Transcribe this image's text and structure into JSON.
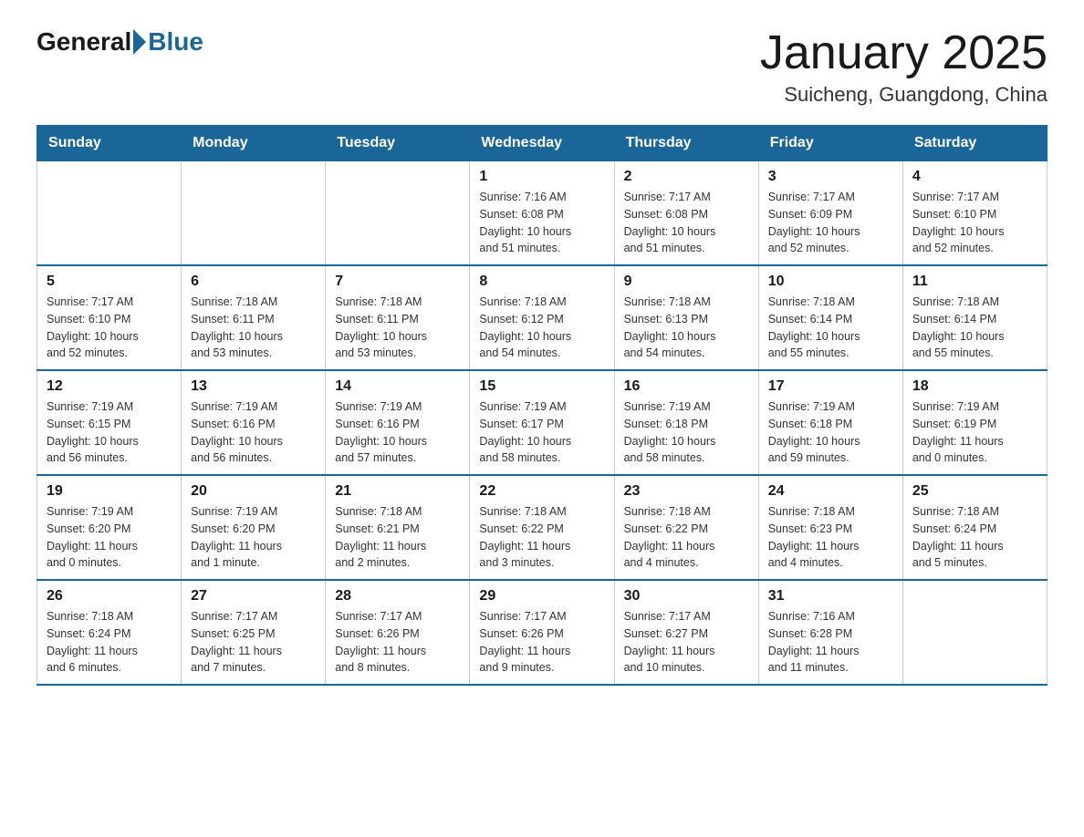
{
  "header": {
    "logo_general": "General",
    "logo_blue": "Blue",
    "month_title": "January 2025",
    "location": "Suicheng, Guangdong, China"
  },
  "days_of_week": [
    "Sunday",
    "Monday",
    "Tuesday",
    "Wednesday",
    "Thursday",
    "Friday",
    "Saturday"
  ],
  "weeks": [
    [
      {
        "day": "",
        "info": ""
      },
      {
        "day": "",
        "info": ""
      },
      {
        "day": "",
        "info": ""
      },
      {
        "day": "1",
        "info": "Sunrise: 7:16 AM\nSunset: 6:08 PM\nDaylight: 10 hours\nand 51 minutes."
      },
      {
        "day": "2",
        "info": "Sunrise: 7:17 AM\nSunset: 6:08 PM\nDaylight: 10 hours\nand 51 minutes."
      },
      {
        "day": "3",
        "info": "Sunrise: 7:17 AM\nSunset: 6:09 PM\nDaylight: 10 hours\nand 52 minutes."
      },
      {
        "day": "4",
        "info": "Sunrise: 7:17 AM\nSunset: 6:10 PM\nDaylight: 10 hours\nand 52 minutes."
      }
    ],
    [
      {
        "day": "5",
        "info": "Sunrise: 7:17 AM\nSunset: 6:10 PM\nDaylight: 10 hours\nand 52 minutes."
      },
      {
        "day": "6",
        "info": "Sunrise: 7:18 AM\nSunset: 6:11 PM\nDaylight: 10 hours\nand 53 minutes."
      },
      {
        "day": "7",
        "info": "Sunrise: 7:18 AM\nSunset: 6:11 PM\nDaylight: 10 hours\nand 53 minutes."
      },
      {
        "day": "8",
        "info": "Sunrise: 7:18 AM\nSunset: 6:12 PM\nDaylight: 10 hours\nand 54 minutes."
      },
      {
        "day": "9",
        "info": "Sunrise: 7:18 AM\nSunset: 6:13 PM\nDaylight: 10 hours\nand 54 minutes."
      },
      {
        "day": "10",
        "info": "Sunrise: 7:18 AM\nSunset: 6:14 PM\nDaylight: 10 hours\nand 55 minutes."
      },
      {
        "day": "11",
        "info": "Sunrise: 7:18 AM\nSunset: 6:14 PM\nDaylight: 10 hours\nand 55 minutes."
      }
    ],
    [
      {
        "day": "12",
        "info": "Sunrise: 7:19 AM\nSunset: 6:15 PM\nDaylight: 10 hours\nand 56 minutes."
      },
      {
        "day": "13",
        "info": "Sunrise: 7:19 AM\nSunset: 6:16 PM\nDaylight: 10 hours\nand 56 minutes."
      },
      {
        "day": "14",
        "info": "Sunrise: 7:19 AM\nSunset: 6:16 PM\nDaylight: 10 hours\nand 57 minutes."
      },
      {
        "day": "15",
        "info": "Sunrise: 7:19 AM\nSunset: 6:17 PM\nDaylight: 10 hours\nand 58 minutes."
      },
      {
        "day": "16",
        "info": "Sunrise: 7:19 AM\nSunset: 6:18 PM\nDaylight: 10 hours\nand 58 minutes."
      },
      {
        "day": "17",
        "info": "Sunrise: 7:19 AM\nSunset: 6:18 PM\nDaylight: 10 hours\nand 59 minutes."
      },
      {
        "day": "18",
        "info": "Sunrise: 7:19 AM\nSunset: 6:19 PM\nDaylight: 11 hours\nand 0 minutes."
      }
    ],
    [
      {
        "day": "19",
        "info": "Sunrise: 7:19 AM\nSunset: 6:20 PM\nDaylight: 11 hours\nand 0 minutes."
      },
      {
        "day": "20",
        "info": "Sunrise: 7:19 AM\nSunset: 6:20 PM\nDaylight: 11 hours\nand 1 minute."
      },
      {
        "day": "21",
        "info": "Sunrise: 7:18 AM\nSunset: 6:21 PM\nDaylight: 11 hours\nand 2 minutes."
      },
      {
        "day": "22",
        "info": "Sunrise: 7:18 AM\nSunset: 6:22 PM\nDaylight: 11 hours\nand 3 minutes."
      },
      {
        "day": "23",
        "info": "Sunrise: 7:18 AM\nSunset: 6:22 PM\nDaylight: 11 hours\nand 4 minutes."
      },
      {
        "day": "24",
        "info": "Sunrise: 7:18 AM\nSunset: 6:23 PM\nDaylight: 11 hours\nand 4 minutes."
      },
      {
        "day": "25",
        "info": "Sunrise: 7:18 AM\nSunset: 6:24 PM\nDaylight: 11 hours\nand 5 minutes."
      }
    ],
    [
      {
        "day": "26",
        "info": "Sunrise: 7:18 AM\nSunset: 6:24 PM\nDaylight: 11 hours\nand 6 minutes."
      },
      {
        "day": "27",
        "info": "Sunrise: 7:17 AM\nSunset: 6:25 PM\nDaylight: 11 hours\nand 7 minutes."
      },
      {
        "day": "28",
        "info": "Sunrise: 7:17 AM\nSunset: 6:26 PM\nDaylight: 11 hours\nand 8 minutes."
      },
      {
        "day": "29",
        "info": "Sunrise: 7:17 AM\nSunset: 6:26 PM\nDaylight: 11 hours\nand 9 minutes."
      },
      {
        "day": "30",
        "info": "Sunrise: 7:17 AM\nSunset: 6:27 PM\nDaylight: 11 hours\nand 10 minutes."
      },
      {
        "day": "31",
        "info": "Sunrise: 7:16 AM\nSunset: 6:28 PM\nDaylight: 11 hours\nand 11 minutes."
      },
      {
        "day": "",
        "info": ""
      }
    ]
  ]
}
